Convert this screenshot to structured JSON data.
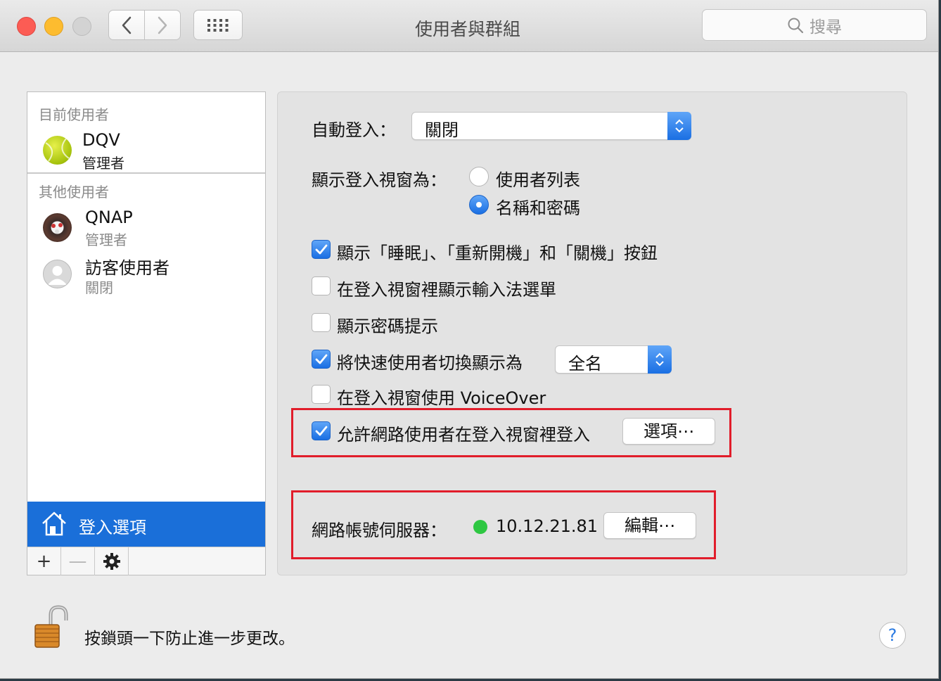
{
  "window": {
    "title": "使用者與群組",
    "search_placeholder": "搜尋"
  },
  "sidebar": {
    "current_header": "目前使用者",
    "other_header": "其他使用者",
    "current_user": {
      "name": "DQV",
      "role": "管理者"
    },
    "other_users": [
      {
        "name": "QNAP",
        "role": "管理者"
      },
      {
        "name": "訪客使用者",
        "role": "關閉"
      }
    ],
    "login_options_label": "登入選項",
    "add_label": "+",
    "remove_label": "—"
  },
  "panel": {
    "auto_login_label": "自動登入：",
    "auto_login_value": "關閉",
    "display_as_label": "顯示登入視窗為：",
    "display_options": [
      {
        "label": "使用者列表",
        "selected": false
      },
      {
        "label": "名稱和密碼",
        "selected": true
      }
    ],
    "checkboxes": [
      {
        "label": "顯示「睡眠」、「重新開機」和「關機」按鈕",
        "checked": true
      },
      {
        "label": "在登入視窗裡顯示輸入法選單",
        "checked": false
      },
      {
        "label": "顯示密碼提示",
        "checked": false
      },
      {
        "label": "將快速使用者切換顯示為",
        "checked": true
      },
      {
        "label": "在登入視窗使用 VoiceOver",
        "checked": false
      },
      {
        "label": "允許網路使用者在登入視窗裡登入",
        "checked": true
      }
    ],
    "fast_switch_value": "全名",
    "options_button": "選項⋯",
    "network_server_label": "網路帳號伺服器：",
    "network_server_value": "10.12.21.81",
    "network_server_status_color": "#2ec742",
    "edit_button": "編輯⋯"
  },
  "footer": {
    "lock_text": "按鎖頭一下防止進一步更改。",
    "help_label": "?"
  },
  "colors": {
    "accent": "#1a6fd9",
    "highlight_box": "#e11d2b"
  }
}
